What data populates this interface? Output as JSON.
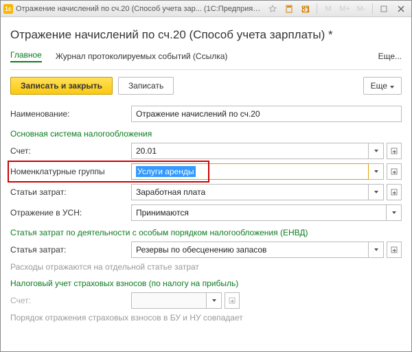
{
  "titlebar": {
    "title": "Отражение начислений по сч.20 (Способ учета зар...   (1С:Предприятие)"
  },
  "page_title": "Отражение начислений по сч.20 (Способ учета зарплаты) *",
  "nav": {
    "main": "Главное",
    "journal": "Журнал протоколируемых событий (Ссылка)",
    "more": "Еще..."
  },
  "toolbar": {
    "save_close": "Записать и закрыть",
    "save": "Записать",
    "more": "Еще"
  },
  "form": {
    "name_label": "Наименование:",
    "name_value": "Отражение начислений по сч.20",
    "section1": "Основная система налогообложения",
    "account_label": "Счет:",
    "account_value": "20.01",
    "nomgroup_label": "Номенклатурные группы",
    "nomgroup_value": "Услуги аренды",
    "cost_label": "Статьи затрат:",
    "cost_value": "Заработная плата",
    "usn_label": "Отражение в УСН:",
    "usn_value": "Принимаются",
    "section2": "Статья затрат по деятельности с особым порядком налогообложения (ЕНВД)",
    "cost2_label": "Статья затрат:",
    "cost2_value": "Резервы по обесценению запасов",
    "note1": "Расходы отражаются на отдельной статье затрат",
    "section3": "Налоговый учет страховых взносов (по налогу на прибыль)",
    "account2_label": "Счет:",
    "account2_value": "",
    "note2": "Порядок отражения страховых взносов в БУ и НУ совпадает"
  }
}
